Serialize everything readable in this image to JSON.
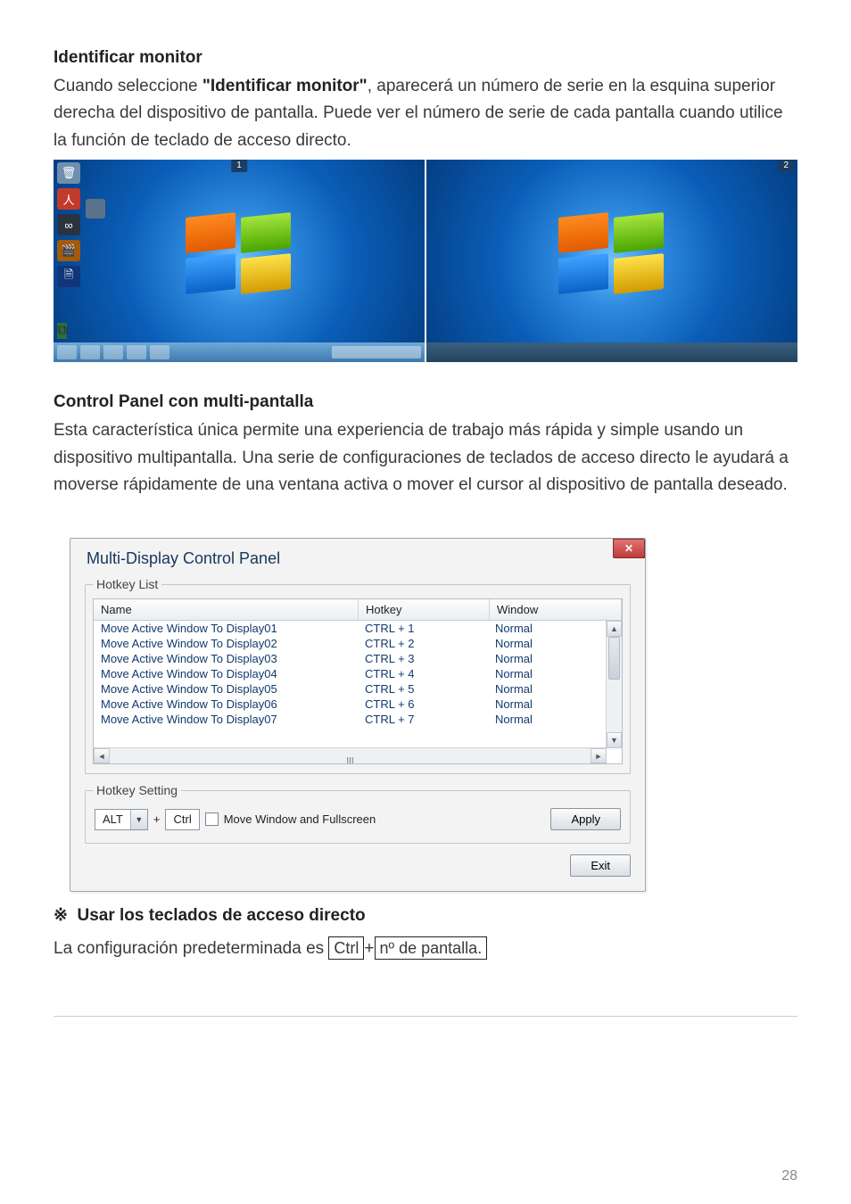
{
  "section1": {
    "heading": "Identificar monitor",
    "para_pre": "Cuando seleccione ",
    "para_bold": "\"Identificar monitor\"",
    "para_post": ", aparecerá un número de serie en la esquina superior derecha del dispositivo de pantalla. Puede ver el número de serie de cada pantalla cuando utilice la función de teclado de acceso directo."
  },
  "desktops": {
    "badge_left": "1",
    "badge_right": "2"
  },
  "section2": {
    "heading": "Control Panel con multi-pantalla",
    "para": "Esta característica única permite una experiencia de trabajo más rápida y simple usando un dispositivo multipantalla. Una serie de configuraciones de teclados de acceso directo le ayudará a moverse rápidamente de una ventana activa o mover el cursor al dispositivo de pantalla deseado."
  },
  "dialog": {
    "title": "Multi-Display Control Panel",
    "close_glyph": "✕",
    "group_list": "Hotkey List",
    "columns": {
      "name": "Name",
      "hotkey": "Hotkey",
      "window": "Window"
    },
    "rows": [
      {
        "name": "Move Active Window To Display01",
        "hotkey": "CTRL + 1",
        "window": "Normal"
      },
      {
        "name": "Move Active Window To Display02",
        "hotkey": "CTRL + 2",
        "window": "Normal"
      },
      {
        "name": "Move Active Window To Display03",
        "hotkey": "CTRL + 3",
        "window": "Normal"
      },
      {
        "name": "Move Active Window To Display04",
        "hotkey": "CTRL + 4",
        "window": "Normal"
      },
      {
        "name": "Move Active Window To Display05",
        "hotkey": "CTRL + 5",
        "window": "Normal"
      },
      {
        "name": "Move Active Window To Display06",
        "hotkey": "CTRL + 6",
        "window": "Normal"
      },
      {
        "name": "Move Active Window To Display07",
        "hotkey": "CTRL + 7",
        "window": "Normal"
      }
    ],
    "group_setting": "Hotkey Setting",
    "modifier_primary": "ALT",
    "plus": "+",
    "modifier_secondary": "Ctrl",
    "checkbox_label": "Move Window and Fullscreen",
    "apply": "Apply",
    "exit": "Exit"
  },
  "footer": {
    "note_symbol": "※",
    "note_heading": "Usar los teclados de acceso directo",
    "config_pre": "La configuración predeterminada es",
    "key1": "Ctrl",
    "key_plus": "+",
    "key2": "nº de pantalla."
  },
  "page_number": "28"
}
